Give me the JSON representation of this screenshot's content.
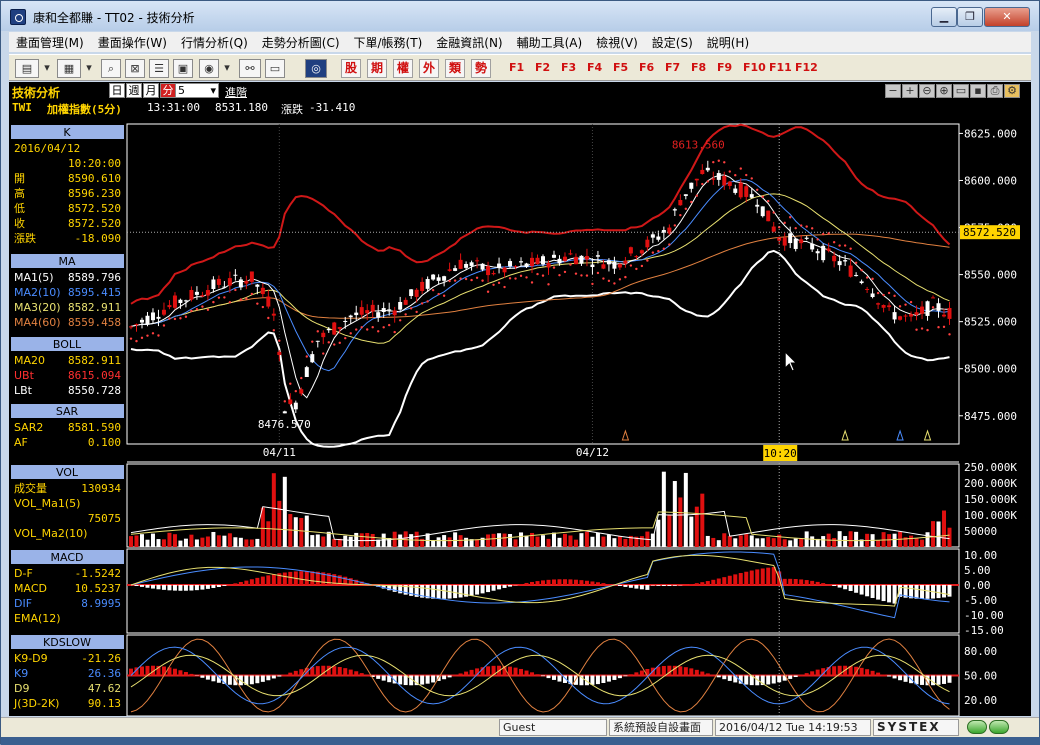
{
  "window": {
    "title": "康和全都賺 - TT02 - 技術分析"
  },
  "menu": [
    "畫面管理(M)",
    "畫面操作(W)",
    "行情分析(Q)",
    "走勢分析圖(C)",
    "下單/帳務(T)",
    "金融資訊(N)",
    "輔助工具(A)",
    "檢視(V)",
    "設定(S)",
    "說明(H)"
  ],
  "toolbar": {
    "red_buttons": [
      "股",
      "期",
      "權",
      "外",
      "類",
      "勢"
    ],
    "fkeys": [
      "F1",
      "F2",
      "F3",
      "F4",
      "F5",
      "F6",
      "F7",
      "F8",
      "F9",
      "F10",
      "F11",
      "F12"
    ]
  },
  "header": {
    "panel_title": "技術分析",
    "period_tabs": [
      "日",
      "週",
      "月",
      "分"
    ],
    "active_period": "分",
    "interval_value": "5",
    "advanced": "進階",
    "symbol": "TWI",
    "name": "加權指數(5分)",
    "time": "13:31:00",
    "price": "8531.180",
    "change_label": "漲跌",
    "change": "-31.410"
  },
  "panels": {
    "k": {
      "title": "K",
      "date": "2016/04/12",
      "time": "10:20:00",
      "rows": [
        {
          "label": "開",
          "value": "8590.610"
        },
        {
          "label": "高",
          "value": "8596.230"
        },
        {
          "label": "低",
          "value": "8572.520"
        },
        {
          "label": "收",
          "value": "8572.520"
        },
        {
          "label": "漲跌",
          "value": "-18.090"
        }
      ]
    },
    "ma": {
      "title": "MA",
      "rows": [
        {
          "label": "MA1(5)",
          "value": "8589.796"
        },
        {
          "label": "MA2(10)",
          "value": "8595.415"
        },
        {
          "label": "MA3(20)",
          "value": "8582.911"
        },
        {
          "label": "MA4(60)",
          "value": "8559.458"
        }
      ]
    },
    "boll": {
      "title": "BOLL",
      "rows": [
        {
          "label": "MA20",
          "value": "8582.911"
        },
        {
          "label": "UBt",
          "value": "8615.094"
        },
        {
          "label": "LBt",
          "value": "8550.728"
        }
      ]
    },
    "sar": {
      "title": "SAR",
      "rows": [
        {
          "label": "SAR2",
          "value": "8581.590"
        },
        {
          "label": "AF",
          "value": "0.100"
        }
      ]
    },
    "vol": {
      "title": "VOL",
      "rows": [
        {
          "label": "成交量",
          "value": "130934"
        },
        {
          "label": "VOL_Ma1(5)",
          "value": ""
        },
        {
          "label": "",
          "value": "75075"
        },
        {
          "label": "VOL_Ma2(10)",
          "value": ""
        }
      ]
    },
    "macd": {
      "title": "MACD",
      "rows": [
        {
          "label": "D-F",
          "value": "-1.5242"
        },
        {
          "label": "MACD",
          "value": "10.5237"
        },
        {
          "label": "DIF",
          "value": "8.9995"
        },
        {
          "label": "EMA(12)",
          "value": ""
        }
      ]
    },
    "kd": {
      "title": "KDSLOW",
      "rows": [
        {
          "label": "K9-D9",
          "value": "-21.26"
        },
        {
          "label": "K9",
          "value": "26.36"
        },
        {
          "label": "D9",
          "value": "47.62"
        },
        {
          "label": "J(3D-2K)",
          "value": "90.13"
        }
      ]
    }
  },
  "chart_data": {
    "type": "candlestick",
    "price_axis": {
      "ticks": [
        "8625.000",
        "8600.000",
        "8575.000",
        "8550.000",
        "8525.000",
        "8500.000",
        "8475.000"
      ],
      "range": [
        8460,
        8630
      ]
    },
    "date_labels": [
      "04/11",
      "04/12"
    ],
    "cursor_time": "10:20",
    "cursor_price": "8572.520",
    "annotations": {
      "high": "8613.560",
      "low": "8476.570"
    },
    "volume_axis": {
      "ticks": [
        "250.000K",
        "200.000K",
        "150.000K",
        "100.000K",
        "50000"
      ]
    },
    "macd_axis": {
      "ticks": [
        "10.00",
        "5.00",
        "0.00",
        "-5.00",
        "-10.00",
        "-15.00"
      ]
    },
    "kd_axis": {
      "ticks": [
        "80.00",
        "50.00",
        "20.00"
      ]
    },
    "colors": {
      "up": "#e01010",
      "down": "#ffffff",
      "boll": "#d01818",
      "ma5": "#ffffff",
      "ma10": "#4a8cff",
      "ma20": "#e8e070",
      "ma60": "#e08040",
      "sar": "#ff4040",
      "grid": "#2a2a2a",
      "panel_title_bg": "#9ab3e8"
    }
  },
  "status": {
    "user": "Guest",
    "layout": "系統預設自設畫面",
    "datetime": "2016/04/12 Tue 14:19:53",
    "brand": "SYSTEX"
  }
}
